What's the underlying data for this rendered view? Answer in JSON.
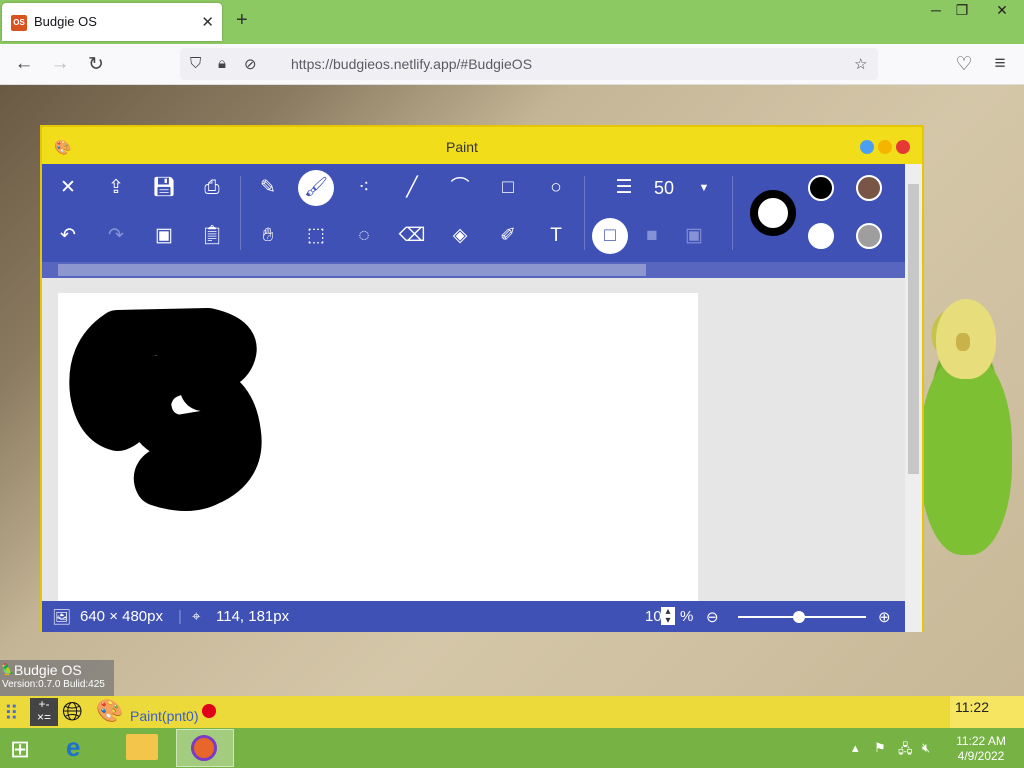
{
  "browser": {
    "tab_title": "Budgie OS",
    "tab_favicon": "OS",
    "url_host": "https://budgieos.netlify.app/",
    "url_hash": "#BudgieOS",
    "icons": [
      "back-icon",
      "forward-icon",
      "reload-icon",
      "shield-icon",
      "lock-icon",
      "permissions-icon",
      "star-icon",
      "pocket-icon",
      "menu-icon"
    ]
  },
  "paint": {
    "title": "Paint",
    "brush_size": "50",
    "image_size": "640 × 480px",
    "cursor_pos": "114, 181px",
    "zoom": "10",
    "zoom_unit": "%",
    "zoom_slider_level": 0.48,
    "colors": {
      "toolbar": "#3f51b5",
      "titlebar": "#f2dd1a",
      "swatch_black": "#000000",
      "swatch_brown": "#795548",
      "swatch_white": "#ffffff",
      "swatch_gray": "#9e9e9e"
    }
  },
  "os": {
    "name": "Budgie OS",
    "version": "Version:0.7.0  Bulid:425"
  },
  "budgie_taskbar": {
    "app": "Paint(pnt0)",
    "clock": "11:22"
  },
  "windows_taskbar": {
    "time": "11:22 AM",
    "date": "4/9/2022"
  }
}
